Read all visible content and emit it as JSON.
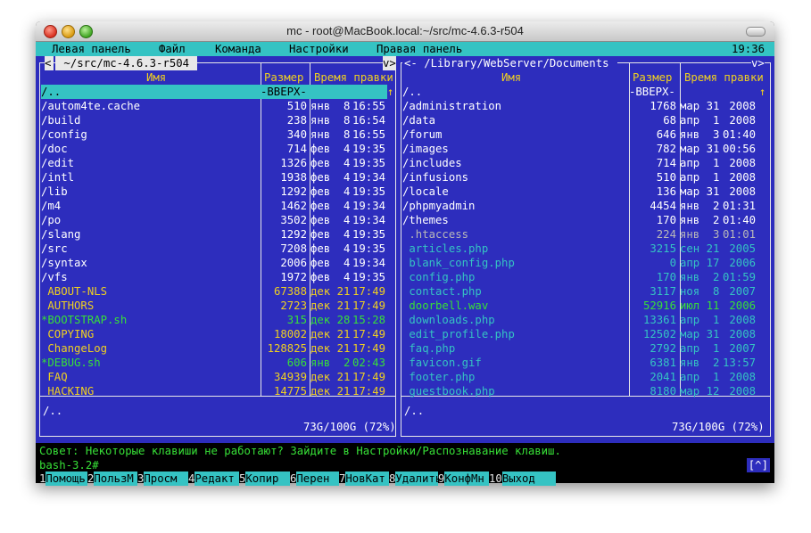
{
  "window": {
    "title": "mc - root@MacBook.local:~/src/mc-4.6.3-r504"
  },
  "menubar": {
    "items": [
      "Левая панель",
      "Файл",
      "Команда",
      "Настройки",
      "Правая панель"
    ],
    "clock": "19:36"
  },
  "left_panel": {
    "path": " ~/src/mc-4.6.3-r504 ",
    "left_button": "<",
    "right_button": "v>",
    "headers": {
      "name": "Имя",
      "size": "Размер",
      "time": "Время правки"
    },
    "up_marker": "↑",
    "rows": [
      {
        "name": "/..",
        "size": "-ВВЕРХ-",
        "date": "",
        "time": "",
        "kind": "up"
      },
      {
        "name": "/autom4te.cache",
        "size": "510",
        "date": "янв  8",
        "time": "16:55",
        "kind": "dir"
      },
      {
        "name": "/build",
        "size": "238",
        "date": "янв  8",
        "time": "16:54",
        "kind": "dir"
      },
      {
        "name": "/config",
        "size": "340",
        "date": "янв  8",
        "time": "16:55",
        "kind": "dir"
      },
      {
        "name": "/doc",
        "size": "714",
        "date": "фев  4",
        "time": "19:35",
        "kind": "dir"
      },
      {
        "name": "/edit",
        "size": "1326",
        "date": "фев  4",
        "time": "19:35",
        "kind": "dir"
      },
      {
        "name": "/intl",
        "size": "1938",
        "date": "фев  4",
        "time": "19:34",
        "kind": "dir"
      },
      {
        "name": "/lib",
        "size": "1292",
        "date": "фев  4",
        "time": "19:35",
        "kind": "dir"
      },
      {
        "name": "/m4",
        "size": "1462",
        "date": "фев  4",
        "time": "19:34",
        "kind": "dir"
      },
      {
        "name": "/po",
        "size": "3502",
        "date": "фев  4",
        "time": "19:34",
        "kind": "dir"
      },
      {
        "name": "/slang",
        "size": "1292",
        "date": "фев  4",
        "time": "19:35",
        "kind": "dir"
      },
      {
        "name": "/src",
        "size": "7208",
        "date": "фев  4",
        "time": "19:35",
        "kind": "dir"
      },
      {
        "name": "/syntax",
        "size": "2006",
        "date": "фев  4",
        "time": "19:34",
        "kind": "dir"
      },
      {
        "name": "/vfs",
        "size": "1972",
        "date": "фев  4",
        "time": "19:35",
        "kind": "dir"
      },
      {
        "name": " ABOUT-NLS",
        "size": "67388",
        "date": "дек 21",
        "time": "17:49",
        "kind": "yellow"
      },
      {
        "name": " AUTHORS",
        "size": "2723",
        "date": "дек 21",
        "time": "17:49",
        "kind": "yellow"
      },
      {
        "name": "*BOOTSTRAP.sh",
        "size": "315",
        "date": "дек 28",
        "time": "15:28",
        "kind": "green"
      },
      {
        "name": " COPYING",
        "size": "18002",
        "date": "дек 21",
        "time": "17:49",
        "kind": "yellow"
      },
      {
        "name": " ChangeLog",
        "size": "128825",
        "date": "дек 21",
        "time": "17:49",
        "kind": "yellow"
      },
      {
        "name": "*DEBUG.sh",
        "size": "606",
        "date": "янв  2",
        "time": "02:43",
        "kind": "green"
      },
      {
        "name": " FAQ",
        "size": "34939",
        "date": "дек 21",
        "time": "17:49",
        "kind": "yellow"
      },
      {
        "name": " HACKING",
        "size": "14775",
        "date": "дек 21",
        "time": "17:49",
        "kind": "yellow"
      }
    ],
    "info": "/..",
    "usage": "73G/100G (72%)"
  },
  "right_panel": {
    "path": "<- /Library/WebServer/Documents ",
    "right_button": "v>",
    "headers": {
      "name": "Имя",
      "size": "Размер",
      "time": "Время правки"
    },
    "up_marker": "↑",
    "rows": [
      {
        "name": "/..",
        "size": "-ВВЕРХ-",
        "date": "",
        "time": "",
        "kind": "up"
      },
      {
        "name": "/administration",
        "size": "1768",
        "date": "мар 31",
        "time": " 2008",
        "kind": "dir"
      },
      {
        "name": "/data",
        "size": "68",
        "date": "апр  1",
        "time": " 2008",
        "kind": "dir"
      },
      {
        "name": "/forum",
        "size": "646",
        "date": "янв  3",
        "time": "01:40",
        "kind": "dir"
      },
      {
        "name": "/images",
        "size": "782",
        "date": "мар 31",
        "time": "00:56",
        "kind": "dir"
      },
      {
        "name": "/includes",
        "size": "714",
        "date": "апр  1",
        "time": " 2008",
        "kind": "dir"
      },
      {
        "name": "/infusions",
        "size": "510",
        "date": "апр  1",
        "time": " 2008",
        "kind": "dir"
      },
      {
        "name": "/locale",
        "size": "136",
        "date": "мар 31",
        "time": " 2008",
        "kind": "dir"
      },
      {
        "name": "/phpmyadmin",
        "size": "4454",
        "date": "янв  2",
        "time": "01:31",
        "kind": "dir"
      },
      {
        "name": "/themes",
        "size": "170",
        "date": "янв  2",
        "time": "01:40",
        "kind": "dir"
      },
      {
        "name": " .htaccess",
        "size": "224",
        "date": "янв  3",
        "time": "01:01",
        "kind": "grey"
      },
      {
        "name": " articles.php",
        "size": "3215",
        "date": "сен 21",
        "time": " 2005",
        "kind": "cyan"
      },
      {
        "name": " blank_config.php",
        "size": "0",
        "date": "апр 17",
        "time": " 2006",
        "kind": "cyan"
      },
      {
        "name": " config.php",
        "size": "170",
        "date": "янв  2",
        "time": "01:59",
        "kind": "cyan"
      },
      {
        "name": " contact.php",
        "size": "3117",
        "date": "ноя  8",
        "time": " 2007",
        "kind": "cyan"
      },
      {
        "name": " doorbell.wav",
        "size": "52916",
        "date": "июл 11",
        "time": " 2006",
        "kind": "green"
      },
      {
        "name": " downloads.php",
        "size": "13361",
        "date": "апр  1",
        "time": " 2008",
        "kind": "cyan"
      },
      {
        "name": " edit_profile.php",
        "size": "12502",
        "date": "мар 31",
        "time": " 2008",
        "kind": "cyan"
      },
      {
        "name": " faq.php",
        "size": "2792",
        "date": "апр  1",
        "time": " 2007",
        "kind": "cyan"
      },
      {
        "name": " favicon.gif",
        "size": "6381",
        "date": "янв  2",
        "time": "13:57",
        "kind": "cyan"
      },
      {
        "name": " footer.php",
        "size": "2041",
        "date": "апр  1",
        "time": " 2008",
        "kind": "cyan"
      },
      {
        "name": " guestbook.php",
        "size": "8180",
        "date": "мар 12",
        "time": " 2008",
        "kind": "cyan"
      }
    ],
    "info": "/..",
    "usage": "73G/100G (72%)"
  },
  "hint": "Совет: Некоторые клавиши не работают? Зайдите в Настройки/Распознавание клавиш.",
  "prompt": "bash-3.2#",
  "anchor_mark": "[^]",
  "function_keys": [
    {
      "num": "1",
      "label": "Помощь"
    },
    {
      "num": "2",
      "label": "ПользМ"
    },
    {
      "num": "3",
      "label": "Просм"
    },
    {
      "num": "4",
      "label": "Редакт"
    },
    {
      "num": "5",
      "label": "Копир"
    },
    {
      "num": "6",
      "label": "Перен"
    },
    {
      "num": "7",
      "label": "НовКат"
    },
    {
      "num": "8",
      "label": "Удалить"
    },
    {
      "num": "9",
      "label": "КонфМн"
    },
    {
      "num": "10",
      "label": "Выход"
    }
  ],
  "colors": {
    "panel_bg": "#2d2dbd",
    "cyan": "#35c3c3",
    "yellow": "#f0d020",
    "green": "#37e037"
  }
}
